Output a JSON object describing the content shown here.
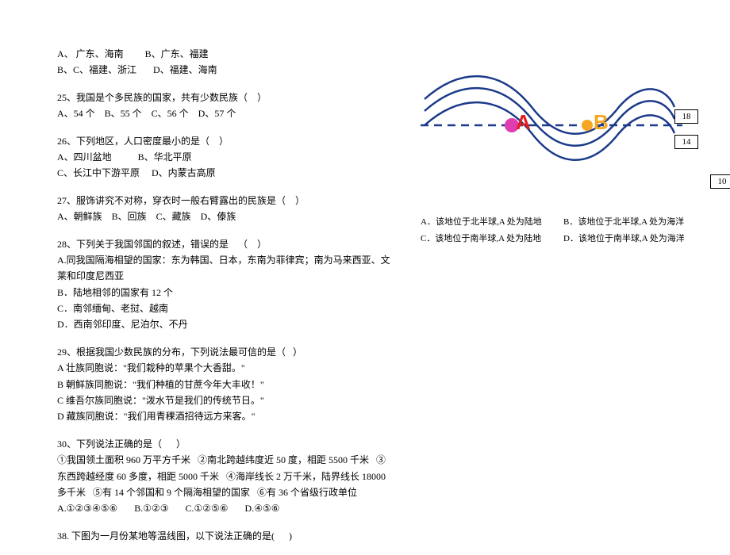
{
  "prev_options": {
    "row1": "A、 广东、海南         B、广东、福建",
    "row2": "B、C、福建、浙江       D、福建、海南"
  },
  "q25": {
    "stem": "25、我国是个多民族的国家，共有少数民族（    ）",
    "opts": "A、54 个    B、55 个    C、56 个    D、57 个"
  },
  "q26": {
    "stem": "26、下列地区，人口密度最小的是（    ）",
    "row1": "A、四川盆地           B、华北平原",
    "row2": "C、长江中下游平原     D、内蒙古高原"
  },
  "q27": {
    "stem": "27、服饰讲究不对称，穿衣时一般右臂露出的民族是（    ）",
    "opts": "A、朝鲜族    B、回族    C、藏族    D、傣族"
  },
  "q28": {
    "stem": "28、下列关于我国邻国的叙述，错误的是    （    ）",
    "a": "A.同我国隔海相望的国家：东为韩国、日本，东南为菲律宾；南为马来西亚、文莱和印度尼西亚",
    "b": "B．陆地相邻的国家有 12 个",
    "c": "C．南邻缅甸、老挝、越南",
    "d": "D．西南邻印度、尼泊尔、不丹"
  },
  "q29": {
    "stem": "29、根据我国少数民族的分布，下列说法最可信的是（   ）",
    "a": "A 壮族同胞说：\"我们栽种的苹果个大香甜。\"",
    "b": "B 朝鲜族同胞说：\"我们种植的甘蔗今年大丰收！\"",
    "c": "C 维吾尔族同胞说：\"泼水节是我们的传统节日。\"",
    "d": "D 藏族同胞说：\"我们用青稞酒招待远方来客。\""
  },
  "q30": {
    "stem": "30、下列说法正确的是（      ）",
    "body": "①我国领土面积 960 万平方千米   ②南北跨越纬度近 50 度，相距 5500 千米   ③东西跨越经度 60 多度，相距 5000 千米   ④海岸线长 2 万千米，陆界线长 18000 多千米   ⑤有 14 个邻国和 9 个隔海相望的国家   ⑥有 36 个省级行政单位",
    "opts": "A.①②③④⑤⑥       B.①②③       C.①②⑤⑥       D.④⑤⑥"
  },
  "q38": {
    "stem": "38. 下图为一月份某地等温线图，以下说法正确的是(      )",
    "a": "A．该地位于北半球,A 处为陆地",
    "b": "B．该地位于北半球,A 处为海洋",
    "c": "C．该地位于南半球,A 处为陆地",
    "d": "D．该地位于南半球,A 处为海洋"
  },
  "labels": {
    "l18": "18",
    "l14": "14",
    "l10": "10"
  },
  "markers": {
    "A": "A",
    "B": "B"
  },
  "chart_data": {
    "type": "line",
    "title": "一月份某地等温线图",
    "isotherms": [
      18,
      14,
      10
    ],
    "baseline_isotherm": 14,
    "markers": [
      {
        "name": "A",
        "isotherm_position": "on_baseline_within_northward_bulge"
      },
      {
        "name": "B",
        "isotherm_position": "on_baseline_within_southward_bulge"
      }
    ],
    "xlabel": "",
    "ylabel": ""
  }
}
